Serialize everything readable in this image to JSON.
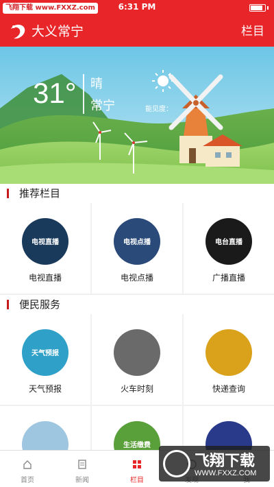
{
  "status_bar": {
    "watermark": "飞翔下载 www.FXXZ.com",
    "time": "6:31 PM",
    "battery_level": 0.85
  },
  "app_bar": {
    "title": "大义常宁",
    "menu_label": "栏目"
  },
  "weather": {
    "temperature": "31°",
    "condition": "晴",
    "city": "常宁",
    "visibility_label": "能见度："
  },
  "recommended": {
    "heading": "推荐栏目",
    "items": [
      {
        "label": "电视直播",
        "image_text": "电视直播",
        "icon": "tv-live-icon",
        "color": "#1a3a5c"
      },
      {
        "label": "电视点播",
        "image_text": "电视点播",
        "icon": "tv-vod-icon",
        "color": "#2a4a7a"
      },
      {
        "label": "广播直播",
        "image_text": "电台直播",
        "icon": "radio-live-icon",
        "color": "#1a1a1a"
      }
    ]
  },
  "services": {
    "heading": "便民服务",
    "items": [
      {
        "label": "天气预报",
        "image_text": "天气预报",
        "icon": "weather-forecast-icon",
        "color": "#2fa0c8"
      },
      {
        "label": "火车时刻",
        "image_text": "",
        "icon": "train-schedule-icon",
        "color": "#6a6a6a"
      },
      {
        "label": "快递查询",
        "image_text": "",
        "icon": "express-query-icon",
        "color": "#d9a21a"
      },
      {
        "label": "",
        "image_text": "",
        "icon": "medical-icon",
        "color": "#9fc6e0"
      },
      {
        "label": "",
        "image_text": "生活缴费",
        "icon": "life-payment-icon",
        "color": "#5aa03a"
      },
      {
        "label": "",
        "image_text": "",
        "icon": "police-icon",
        "color": "#2a3a8a"
      }
    ]
  },
  "tab_bar": {
    "tabs": [
      {
        "label": "首页",
        "icon": "home-icon"
      },
      {
        "label": "新闻",
        "icon": "news-icon"
      },
      {
        "label": "栏目",
        "icon": "columns-icon"
      },
      {
        "label": "发现",
        "icon": "discover-icon"
      },
      {
        "label": "我",
        "icon": "me-icon"
      }
    ],
    "active_index": 2
  },
  "overlay_watermark": {
    "line1": "飞翔下载",
    "line2": "WWW.FXXZ.COM"
  },
  "colors": {
    "brand_red": "#e8262a",
    "section_bar": "#c8191e"
  }
}
